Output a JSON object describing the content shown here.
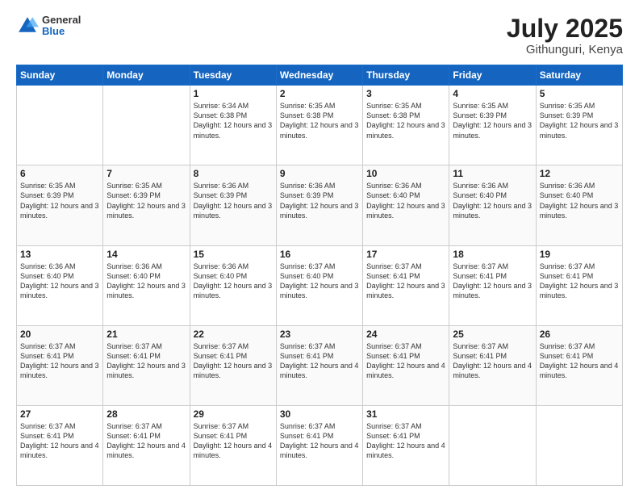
{
  "header": {
    "logo": {
      "general": "General",
      "blue": "Blue"
    },
    "title": "July 2025",
    "location": "Githunguri, Kenya"
  },
  "calendar": {
    "days_of_week": [
      "Sunday",
      "Monday",
      "Tuesday",
      "Wednesday",
      "Thursday",
      "Friday",
      "Saturday"
    ],
    "weeks": [
      [
        {
          "day": "",
          "sunrise": "",
          "sunset": "",
          "daylight": ""
        },
        {
          "day": "",
          "sunrise": "",
          "sunset": "",
          "daylight": ""
        },
        {
          "day": "1",
          "sunrise": "Sunrise: 6:34 AM",
          "sunset": "Sunset: 6:38 PM",
          "daylight": "Daylight: 12 hours and 3 minutes."
        },
        {
          "day": "2",
          "sunrise": "Sunrise: 6:35 AM",
          "sunset": "Sunset: 6:38 PM",
          "daylight": "Daylight: 12 hours and 3 minutes."
        },
        {
          "day": "3",
          "sunrise": "Sunrise: 6:35 AM",
          "sunset": "Sunset: 6:38 PM",
          "daylight": "Daylight: 12 hours and 3 minutes."
        },
        {
          "day": "4",
          "sunrise": "Sunrise: 6:35 AM",
          "sunset": "Sunset: 6:39 PM",
          "daylight": "Daylight: 12 hours and 3 minutes."
        },
        {
          "day": "5",
          "sunrise": "Sunrise: 6:35 AM",
          "sunset": "Sunset: 6:39 PM",
          "daylight": "Daylight: 12 hours and 3 minutes."
        }
      ],
      [
        {
          "day": "6",
          "sunrise": "Sunrise: 6:35 AM",
          "sunset": "Sunset: 6:39 PM",
          "daylight": "Daylight: 12 hours and 3 minutes."
        },
        {
          "day": "7",
          "sunrise": "Sunrise: 6:35 AM",
          "sunset": "Sunset: 6:39 PM",
          "daylight": "Daylight: 12 hours and 3 minutes."
        },
        {
          "day": "8",
          "sunrise": "Sunrise: 6:36 AM",
          "sunset": "Sunset: 6:39 PM",
          "daylight": "Daylight: 12 hours and 3 minutes."
        },
        {
          "day": "9",
          "sunrise": "Sunrise: 6:36 AM",
          "sunset": "Sunset: 6:39 PM",
          "daylight": "Daylight: 12 hours and 3 minutes."
        },
        {
          "day": "10",
          "sunrise": "Sunrise: 6:36 AM",
          "sunset": "Sunset: 6:40 PM",
          "daylight": "Daylight: 12 hours and 3 minutes."
        },
        {
          "day": "11",
          "sunrise": "Sunrise: 6:36 AM",
          "sunset": "Sunset: 6:40 PM",
          "daylight": "Daylight: 12 hours and 3 minutes."
        },
        {
          "day": "12",
          "sunrise": "Sunrise: 6:36 AM",
          "sunset": "Sunset: 6:40 PM",
          "daylight": "Daylight: 12 hours and 3 minutes."
        }
      ],
      [
        {
          "day": "13",
          "sunrise": "Sunrise: 6:36 AM",
          "sunset": "Sunset: 6:40 PM",
          "daylight": "Daylight: 12 hours and 3 minutes."
        },
        {
          "day": "14",
          "sunrise": "Sunrise: 6:36 AM",
          "sunset": "Sunset: 6:40 PM",
          "daylight": "Daylight: 12 hours and 3 minutes."
        },
        {
          "day": "15",
          "sunrise": "Sunrise: 6:36 AM",
          "sunset": "Sunset: 6:40 PM",
          "daylight": "Daylight: 12 hours and 3 minutes."
        },
        {
          "day": "16",
          "sunrise": "Sunrise: 6:37 AM",
          "sunset": "Sunset: 6:40 PM",
          "daylight": "Daylight: 12 hours and 3 minutes."
        },
        {
          "day": "17",
          "sunrise": "Sunrise: 6:37 AM",
          "sunset": "Sunset: 6:41 PM",
          "daylight": "Daylight: 12 hours and 3 minutes."
        },
        {
          "day": "18",
          "sunrise": "Sunrise: 6:37 AM",
          "sunset": "Sunset: 6:41 PM",
          "daylight": "Daylight: 12 hours and 3 minutes."
        },
        {
          "day": "19",
          "sunrise": "Sunrise: 6:37 AM",
          "sunset": "Sunset: 6:41 PM",
          "daylight": "Daylight: 12 hours and 3 minutes."
        }
      ],
      [
        {
          "day": "20",
          "sunrise": "Sunrise: 6:37 AM",
          "sunset": "Sunset: 6:41 PM",
          "daylight": "Daylight: 12 hours and 3 minutes."
        },
        {
          "day": "21",
          "sunrise": "Sunrise: 6:37 AM",
          "sunset": "Sunset: 6:41 PM",
          "daylight": "Daylight: 12 hours and 3 minutes."
        },
        {
          "day": "22",
          "sunrise": "Sunrise: 6:37 AM",
          "sunset": "Sunset: 6:41 PM",
          "daylight": "Daylight: 12 hours and 3 minutes."
        },
        {
          "day": "23",
          "sunrise": "Sunrise: 6:37 AM",
          "sunset": "Sunset: 6:41 PM",
          "daylight": "Daylight: 12 hours and 4 minutes."
        },
        {
          "day": "24",
          "sunrise": "Sunrise: 6:37 AM",
          "sunset": "Sunset: 6:41 PM",
          "daylight": "Daylight: 12 hours and 4 minutes."
        },
        {
          "day": "25",
          "sunrise": "Sunrise: 6:37 AM",
          "sunset": "Sunset: 6:41 PM",
          "daylight": "Daylight: 12 hours and 4 minutes."
        },
        {
          "day": "26",
          "sunrise": "Sunrise: 6:37 AM",
          "sunset": "Sunset: 6:41 PM",
          "daylight": "Daylight: 12 hours and 4 minutes."
        }
      ],
      [
        {
          "day": "27",
          "sunrise": "Sunrise: 6:37 AM",
          "sunset": "Sunset: 6:41 PM",
          "daylight": "Daylight: 12 hours and 4 minutes."
        },
        {
          "day": "28",
          "sunrise": "Sunrise: 6:37 AM",
          "sunset": "Sunset: 6:41 PM",
          "daylight": "Daylight: 12 hours and 4 minutes."
        },
        {
          "day": "29",
          "sunrise": "Sunrise: 6:37 AM",
          "sunset": "Sunset: 6:41 PM",
          "daylight": "Daylight: 12 hours and 4 minutes."
        },
        {
          "day": "30",
          "sunrise": "Sunrise: 6:37 AM",
          "sunset": "Sunset: 6:41 PM",
          "daylight": "Daylight: 12 hours and 4 minutes."
        },
        {
          "day": "31",
          "sunrise": "Sunrise: 6:37 AM",
          "sunset": "Sunset: 6:41 PM",
          "daylight": "Daylight: 12 hours and 4 minutes."
        },
        {
          "day": "",
          "sunrise": "",
          "sunset": "",
          "daylight": ""
        },
        {
          "day": "",
          "sunrise": "",
          "sunset": "",
          "daylight": ""
        }
      ]
    ]
  }
}
